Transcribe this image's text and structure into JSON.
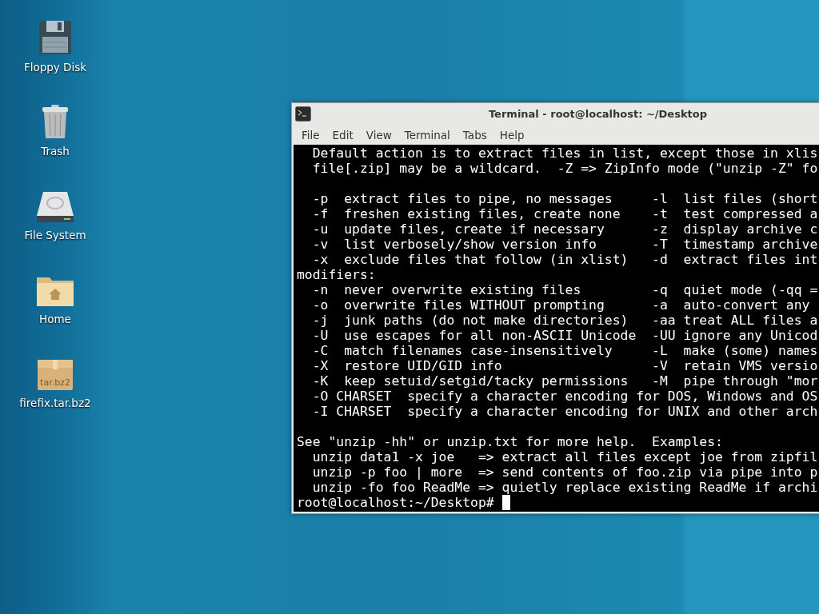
{
  "desktop_icons": [
    {
      "kind": "floppy",
      "label": "Floppy Disk"
    },
    {
      "kind": "trash",
      "label": "Trash"
    },
    {
      "kind": "drive",
      "label": "File System"
    },
    {
      "kind": "home",
      "label": "Home"
    },
    {
      "kind": "archive",
      "label": "firefix.tar.bz2",
      "badge": "tar.bz2"
    }
  ],
  "window": {
    "title": "Terminal - root@localhost: ~/Desktop",
    "menu": [
      "File",
      "Edit",
      "View",
      "Terminal",
      "Tabs",
      "Help"
    ],
    "blocks": [
      [
        "  Default action is to extract files in list, except those in xlis",
        "  file[.zip] may be a wildcard.  -Z => ZipInfo mode (\"unzip -Z\" fo"
      ],
      [
        "  -p  extract files to pipe, no messages     -l  list files (short",
        "  -f  freshen existing files, create none    -t  test compressed a",
        "  -u  update files, create if necessary      -z  display archive c",
        "  -v  list verbosely/show version info       -T  timestamp archive",
        "  -x  exclude files that follow (in xlist)   -d  extract files int",
        "modifiers:",
        "  -n  never overwrite existing files         -q  quiet mode (-qq =",
        "  -o  overwrite files WITHOUT prompting      -a  auto-convert any",
        "  -j  junk paths (do not make directories)   -aa treat ALL files a",
        "  -U  use escapes for all non-ASCII Unicode  -UU ignore any Unicod",
        "  -C  match filenames case-insensitively     -L  make (some) names",
        "  -X  restore UID/GID info                   -V  retain VMS versio",
        "  -K  keep setuid/setgid/tacky permissions   -M  pipe through \"mor",
        "  -O CHARSET  specify a character encoding for DOS, Windows and OS",
        "  -I CHARSET  specify a character encoding for UNIX and other arch"
      ],
      [
        "See \"unzip -hh\" or unzip.txt for more help.  Examples:",
        "  unzip data1 -x joe   => extract all files except joe from zipfil",
        "  unzip -p foo | more  => send contents of foo.zip via pipe into p",
        "  unzip -fo foo ReadMe => quietly replace existing ReadMe if archi"
      ]
    ],
    "prompt": "root@localhost:~/Desktop#"
  }
}
